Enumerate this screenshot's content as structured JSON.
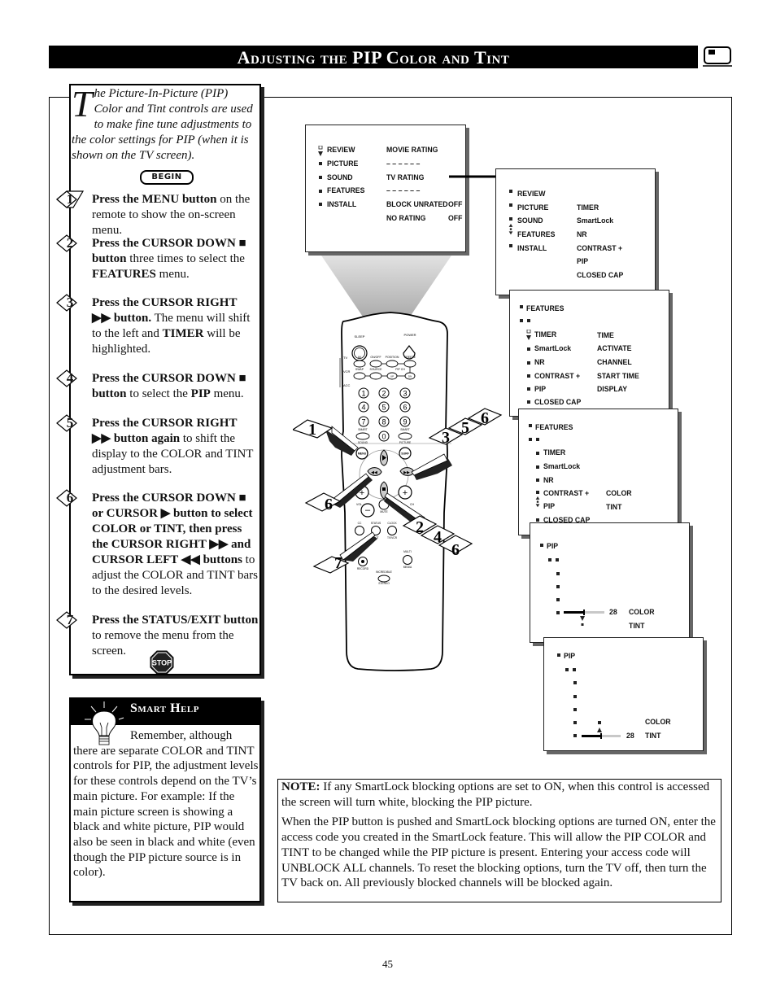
{
  "header": {
    "title": "Adjusting the PIP Color and Tint",
    "icon": "tv-screen-icon"
  },
  "intro": {
    "dropcap": "T",
    "text": "he Picture-In-Picture (PIP) Color and Tint controls are used to make fine tune adjustments to the color settings for PIP (when it is shown on the TV screen).",
    "begin_label": "BEGIN"
  },
  "steps": [
    {
      "num": "1",
      "bold": "Press the MENU button",
      "rest": " on the remote to show the on-screen menu."
    },
    {
      "num": "2",
      "bold": "Press the CURSOR DOWN ■",
      "rest_html_parts": [
        "button",
        " three times to select the ",
        "FEATURES",
        " menu."
      ]
    },
    {
      "num": "3",
      "bold": "Press the CURSOR RIGHT ▶▶ button.",
      "rest": " The menu will shift to the left and ",
      "bold2": "TIMER",
      "rest2": " will be highlighted."
    },
    {
      "num": "4",
      "bold": "Press the CURSOR DOWN ■ button",
      "rest": " to select the ",
      "bold2": "PIP",
      "rest2": " menu."
    },
    {
      "num": "5",
      "bold": "Press the CURSOR RIGHT ▶▶ button again",
      "rest": " to shift the display to the COLOR and TINT adjustment bars."
    },
    {
      "num": "6",
      "bold": "Press the CURSOR DOWN ■ or CURSOR ▶ button to select COLOR or TINT, then press the CURSOR RIGHT ▶▶ and CURSOR LEFT ◀◀ buttons",
      "rest": " to adjust the COLOR and TINT bars to the desired levels."
    },
    {
      "num": "7",
      "bold": "Press the STATUS/EXIT button",
      "rest": " to remove the menu from the screen."
    }
  ],
  "stop_label": "STOP",
  "smart_help": {
    "title": "Smart Help",
    "text": "Remember, although there are separate COLOR and TINT controls for PIP, the adjustment levels for these controls depend on the TV’s main picture. For example: If the main picture screen is showing a black and white picture, PIP would also be seen in black and white (even though the PIP picture source is in color)."
  },
  "screens": {
    "main_menu": {
      "left": [
        "REVIEW",
        "PICTURE",
        "SOUND",
        "FEATURES",
        "INSTALL"
      ],
      "right": [
        "MOVIE RATING",
        "– – – – – –",
        "TV RATING",
        "– – – – – –",
        "BLOCK UNRATED",
        "NO RATING"
      ],
      "right_values": [
        "OFF",
        "OFF"
      ]
    },
    "features_menu": {
      "left": [
        "REVIEW",
        "PICTURE",
        "SOUND",
        "FEATURES",
        "INSTALL"
      ],
      "right": [
        "TIMER",
        "SmartLock",
        "NR",
        "CONTRAST +",
        "PIP",
        "CLOSED CAP"
      ]
    },
    "timer_menu": {
      "heading": "FEATURES",
      "left": [
        "TIMER",
        "SmartLock",
        "NR",
        "CONTRAST +",
        "PIP",
        "CLOSED CAP"
      ],
      "right": [
        "TIME",
        "ACTIVATE",
        "CHANNEL",
        "START TIME",
        "DISPLAY"
      ]
    },
    "pip_menu": {
      "heading": "FEATURES",
      "left": [
        "TIMER",
        "SmartLock",
        "NR",
        "CONTRAST +",
        "PIP",
        "CLOSED CAP"
      ],
      "right": [
        "COLOR",
        "TINT"
      ]
    },
    "color_adjust": {
      "heading": "PIP",
      "value": "28",
      "labels": [
        "COLOR",
        "TINT"
      ],
      "level_fraction": 0.5
    },
    "tint_adjust": {
      "heading": "PIP",
      "value": "28",
      "labels": [
        "COLOR",
        "TINT"
      ],
      "level_fraction": 0.5
    }
  },
  "remote": {
    "labels": {
      "sleep": "SLEEP",
      "power": "POWER",
      "tv": "TV",
      "vcr": "VCR",
      "acc": "ACC",
      "av": "AV",
      "onoff": "ON/OFF",
      "position": "POSITION",
      "freeze": "FREEZE",
      "swap": "SWAP",
      "source": "SOURCE",
      "pipch": "PIP CH",
      "up": "UP",
      "dn": "DN",
      "smart_sound": "SMART",
      "smart_picture": "SMART",
      "sound": "SOUND",
      "picture": "PICTURE",
      "menu": "MENU",
      "surf": "SURF",
      "vol": "VOL",
      "ch": "CH",
      "mute": "MUTE",
      "cc": "CC",
      "status": "STATUS",
      "exit": "EXIT",
      "clock": "CLOCK",
      "tvvcr": "TV/VCR",
      "record": "RECORD",
      "multi": "MULTI",
      "media": "MEDIA",
      "incredible": "INCREDIBLE",
      "stereo": "STEREO"
    },
    "digits": [
      "1",
      "2",
      "3",
      "4",
      "5",
      "6",
      "7",
      "8",
      "9",
      "0"
    ],
    "callouts": [
      {
        "target": "menu",
        "steps": [
          "1"
        ]
      },
      {
        "target": "cursor-right",
        "steps": [
          "3",
          "5",
          "6"
        ]
      },
      {
        "target": "cursor-left",
        "steps": [
          "6"
        ]
      },
      {
        "target": "cursor-down",
        "steps": [
          "2",
          "4",
          "6"
        ]
      },
      {
        "target": "status-exit",
        "steps": [
          "7"
        ]
      }
    ]
  },
  "note": {
    "label": "NOTE:",
    "p1": " If any SmartLock blocking options are set to ON, when this control is accessed the screen will turn white, blocking the PIP picture.",
    "p2": "When the PIP button is pushed and SmartLock blocking options are turned ON, enter the access code you created in the SmartLock feature. This will allow the PIP COLOR and TINT to be changed while the PIP picture is present. Entering your access code will UNBLOCK ALL channels. To reset the blocking options, turn the TV off, then turn the TV back on. All previously blocked channels will be blocked again."
  },
  "page_number": "45"
}
